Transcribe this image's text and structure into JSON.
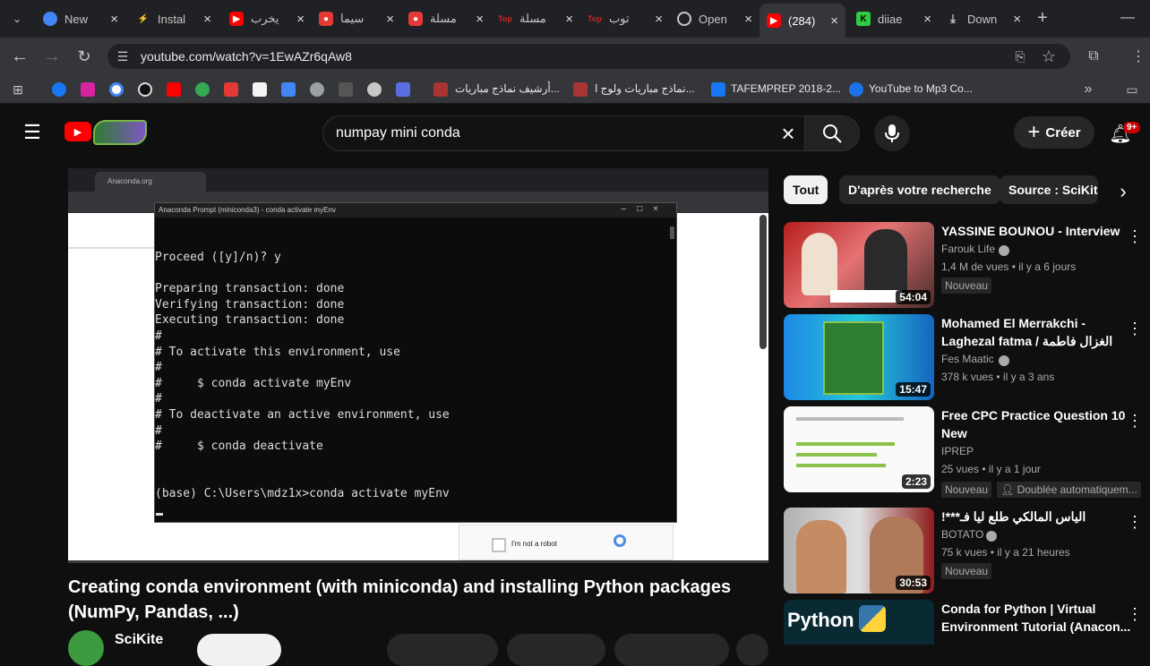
{
  "browser": {
    "tabs": [
      {
        "label": "New",
        "icon": "chrome-icon",
        "color": "#4285f4"
      },
      {
        "label": "Instal",
        "icon": "bolt-icon",
        "color": "#1db954"
      },
      {
        "label": "يخرب",
        "icon": "youtube-icon",
        "color": "#ff0000"
      },
      {
        "label": "سيما",
        "icon": "record-icon",
        "color": "#e53935"
      },
      {
        "label": "مسلة",
        "icon": "record-icon",
        "color": "#e53935"
      },
      {
        "label": "مسلة",
        "icon": "top-icon",
        "color": "#c62828"
      },
      {
        "label": "توب",
        "icon": "top-icon",
        "color": "#c62828"
      },
      {
        "label": "Open",
        "icon": "openai-icon",
        "color": "#9aa0a6"
      },
      {
        "label": "(284)",
        "icon": "youtube-icon",
        "color": "#ff0000"
      },
      {
        "label": "diiae",
        "icon": "k-icon",
        "color": "#2ecc40"
      },
      {
        "label": "Down",
        "icon": "download-icon",
        "color": "#9aa0a6"
      }
    ],
    "url": "youtube.com/watch?v=1EwAZr6qAw8",
    "bookmarks": [
      {
        "label": "أرشيف نماذج مباريات..."
      },
      {
        "label": "نماذج مباريات ولوج ا..."
      },
      {
        "label": "TAFEMPREP 2018-2..."
      },
      {
        "label": "YouTube to Mp3 Co..."
      }
    ]
  },
  "youtube": {
    "search_value": "numpay mini conda",
    "create_label": "Créer",
    "notif_count": "9+"
  },
  "terminal": {
    "window_title": "Anaconda Prompt (miniconda3) - conda activate myEnv",
    "browser_tab": "Anaconda.org",
    "lines": "Proceed ([y]/n)? y\n\nPreparing transaction: done\nVerifying transaction: done\nExecuting transaction: done\n#\n# To activate this environment, use\n#\n#     $ conda activate myEnv\n#\n# To deactivate an active environment, use\n#\n#     $ conda deactivate\n\n\n(base) C:\\Users\\mdz1x>conda activate myEnv",
    "captcha": "I'm not a robot"
  },
  "video": {
    "title": "Creating conda environment (with miniconda) and installing Python packages (NumPy, Pandas, ...)",
    "channel": "SciKite"
  },
  "chips": [
    "Tout",
    "D'après votre recherche",
    "Source : SciKite"
  ],
  "recommendations": [
    {
      "title": "YASSINE BOUNOU - Interview",
      "channel": "Farouk Life",
      "views": "1,4 M de vues • il y a 6 jours",
      "duration": "54:04",
      "badge": "Nouveau",
      "extra": ""
    },
    {
      "title": "Mohamed El Merrakchi - Laghezal fatma / الغزال فاطمة",
      "channel": "Fes Maatic",
      "views": "378 k vues • il y a 3 ans",
      "duration": "15:47",
      "badge": "",
      "extra": ""
    },
    {
      "title": "Free CPC Practice Question 10 New",
      "channel": "IPREP",
      "views": "25 vues • il y a 1 jour",
      "duration": "2:23",
      "badge": "Nouveau",
      "extra": "Doublée automatiquem..."
    },
    {
      "title": "الياس المالكي طلع ليا فـ***!",
      "channel": "BOTATO",
      "views": "75 k vues • il y a 21 heures",
      "duration": "30:53",
      "badge": "Nouveau",
      "extra": ""
    },
    {
      "title": "Conda for Python | Virtual Environment Tutorial (Anacon...",
      "channel": "",
      "views": "",
      "duration": "",
      "badge": "",
      "extra": ""
    }
  ],
  "colors": {
    "youtube_red": "#ff0000",
    "bg": "#0f0f0f"
  }
}
